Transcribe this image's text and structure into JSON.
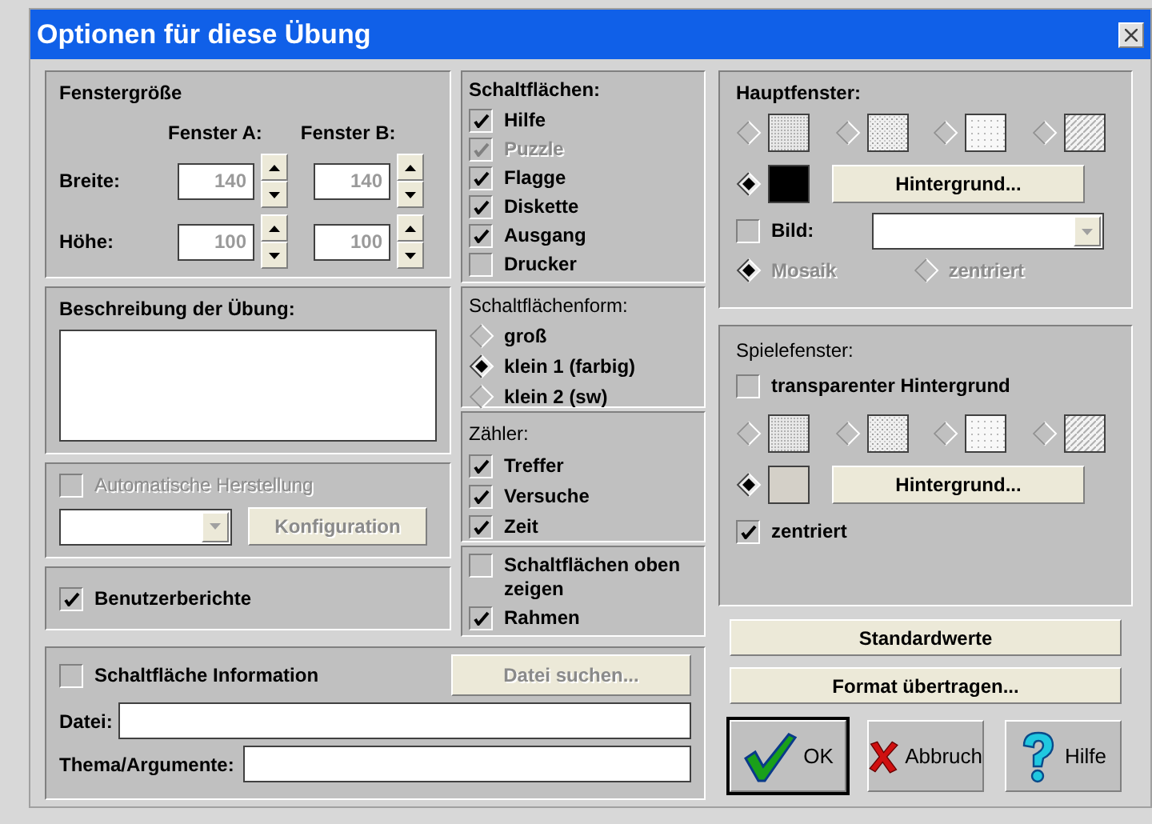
{
  "window": {
    "title": "Optionen für diese Übung"
  },
  "window_size": {
    "title": "Fenstergröße",
    "col_a": "Fenster A:",
    "col_b": "Fenster B:",
    "rows": [
      {
        "label": "Breite:",
        "a": "140",
        "b": "140"
      },
      {
        "label": "Höhe:",
        "a": "100",
        "b": "100"
      }
    ]
  },
  "description": {
    "label": "Beschreibung der Übung:"
  },
  "auto": {
    "label": "Automatische Herstellung",
    "checked": false,
    "disabled": true,
    "config_button": "Konfiguration"
  },
  "user_reports": {
    "label": "Benutzerberichte",
    "checked": true
  },
  "info": {
    "label": "Schaltfläche Information",
    "checked": false,
    "browse_button": "Datei suchen...",
    "file_label": "Datei:",
    "topic_label": "Thema/Argumente:"
  },
  "buttons": {
    "title": "Schaltflächen:",
    "items": [
      {
        "label": "Hilfe",
        "checked": true,
        "disabled": false
      },
      {
        "label": "Puzzle",
        "checked": true,
        "disabled": true
      },
      {
        "label": "Flagge",
        "checked": true,
        "disabled": false
      },
      {
        "label": "Diskette",
        "checked": true,
        "disabled": false
      },
      {
        "label": "Ausgang",
        "checked": true,
        "disabled": false
      },
      {
        "label": "Drucker",
        "checked": false,
        "disabled": false
      }
    ]
  },
  "button_shape": {
    "title": "Schaltflächenform:",
    "options": [
      {
        "label": "groß",
        "selected": false
      },
      {
        "label": "klein 1 (farbig)",
        "selected": true
      },
      {
        "label": "klein 2 (sw)",
        "selected": false
      }
    ]
  },
  "counters": {
    "title": "Zähler:",
    "items": [
      {
        "label": "Treffer",
        "checked": true
      },
      {
        "label": "Versuche",
        "checked": true
      },
      {
        "label": "Zeit",
        "checked": true
      }
    ]
  },
  "misc": {
    "items": [
      {
        "label": "Schaltflächen oben zeigen",
        "checked": false
      },
      {
        "label": "Rahmen",
        "checked": true
      }
    ]
  },
  "main_window": {
    "title": "Hauptfenster:",
    "swatches": [
      {
        "kind": "grid",
        "selected": false
      },
      {
        "kind": "dots",
        "selected": false
      },
      {
        "kind": "fine",
        "selected": false
      },
      {
        "kind": "diagonal",
        "selected": false
      },
      {
        "kind": "solid",
        "color": "#000000",
        "selected": true
      }
    ],
    "background_button": "Hintergrund...",
    "image": {
      "label": "Bild:",
      "checked": false
    },
    "image_disabled": true,
    "layout": [
      {
        "label": "Mosaik",
        "selected": true
      },
      {
        "label": "zentriert",
        "selected": false
      }
    ]
  },
  "game_window": {
    "title": "Spielefenster:",
    "transparent": {
      "label": "transparenter Hintergrund",
      "checked": false
    },
    "swatches": [
      {
        "kind": "grid",
        "selected": false
      },
      {
        "kind": "dots",
        "selected": false
      },
      {
        "kind": "fine",
        "selected": false
      },
      {
        "kind": "diagonal",
        "selected": false
      },
      {
        "kind": "solid",
        "color": "#d4d0c8",
        "selected": true
      }
    ],
    "background_button": "Hintergrund...",
    "centered": {
      "label": "zentriert",
      "checked": true
    }
  },
  "actions": [
    "Standardwerte",
    "Format übertragen..."
  ],
  "dialog_buttons": [
    {
      "kind": "ok",
      "label": "OK"
    },
    {
      "kind": "cancel",
      "label": "Abbruch"
    },
    {
      "kind": "help",
      "label": "Hilfe"
    }
  ]
}
